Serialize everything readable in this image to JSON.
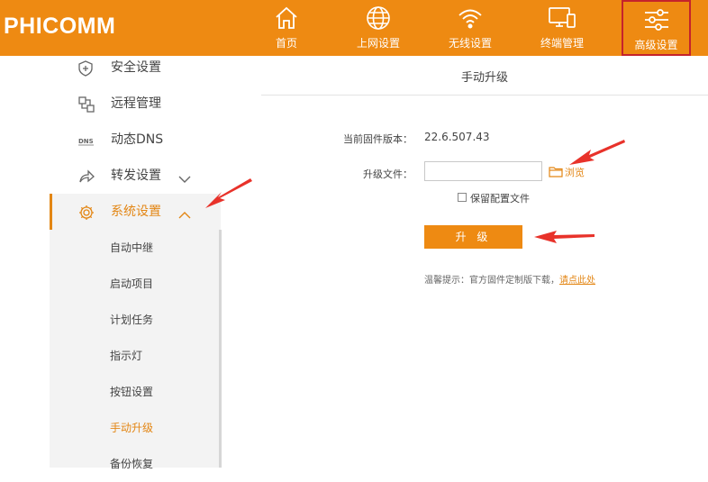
{
  "brand": {
    "logo_text": "PHICOMM"
  },
  "topnav": {
    "items": [
      {
        "label": "首页",
        "icon": "home-icon"
      },
      {
        "label": "上网设置",
        "icon": "globe-icon"
      },
      {
        "label": "无线设置",
        "icon": "wifi-icon"
      },
      {
        "label": "终端管理",
        "icon": "devices-icon"
      },
      {
        "label": "高级设置",
        "icon": "sliders-icon",
        "active": true
      }
    ]
  },
  "sidebar": {
    "items": [
      {
        "label": "安全设置",
        "icon": "shield-icon"
      },
      {
        "label": "远程管理",
        "icon": "remote-icon"
      },
      {
        "label": "动态DNS",
        "icon": "dns-icon"
      },
      {
        "label": "转发设置",
        "icon": "forward-icon"
      },
      {
        "label": "系统设置",
        "icon": "gear-icon",
        "selected": true
      }
    ],
    "subitems": [
      {
        "label": "自动中继"
      },
      {
        "label": "启动项目"
      },
      {
        "label": "计划任务"
      },
      {
        "label": "指示灯"
      },
      {
        "label": "按钮设置"
      },
      {
        "label": "手动升级",
        "current": true
      },
      {
        "label": "备份恢复"
      }
    ]
  },
  "main": {
    "title": "手动升级",
    "firmware_label": "当前固件版本：",
    "firmware_value": "22.6.507.43",
    "file_label": "升级文件：",
    "file_value": "",
    "browse_label": "浏览",
    "keep_config_label": "保留配置文件",
    "upgrade_button": "升 级",
    "hint_text": "温馨提示：官方固件定制版下载，",
    "hint_link": "请点此处"
  },
  "colors": {
    "accent": "#ee8a12",
    "active_border": "#c5232b",
    "arrow": "#e8322a"
  }
}
